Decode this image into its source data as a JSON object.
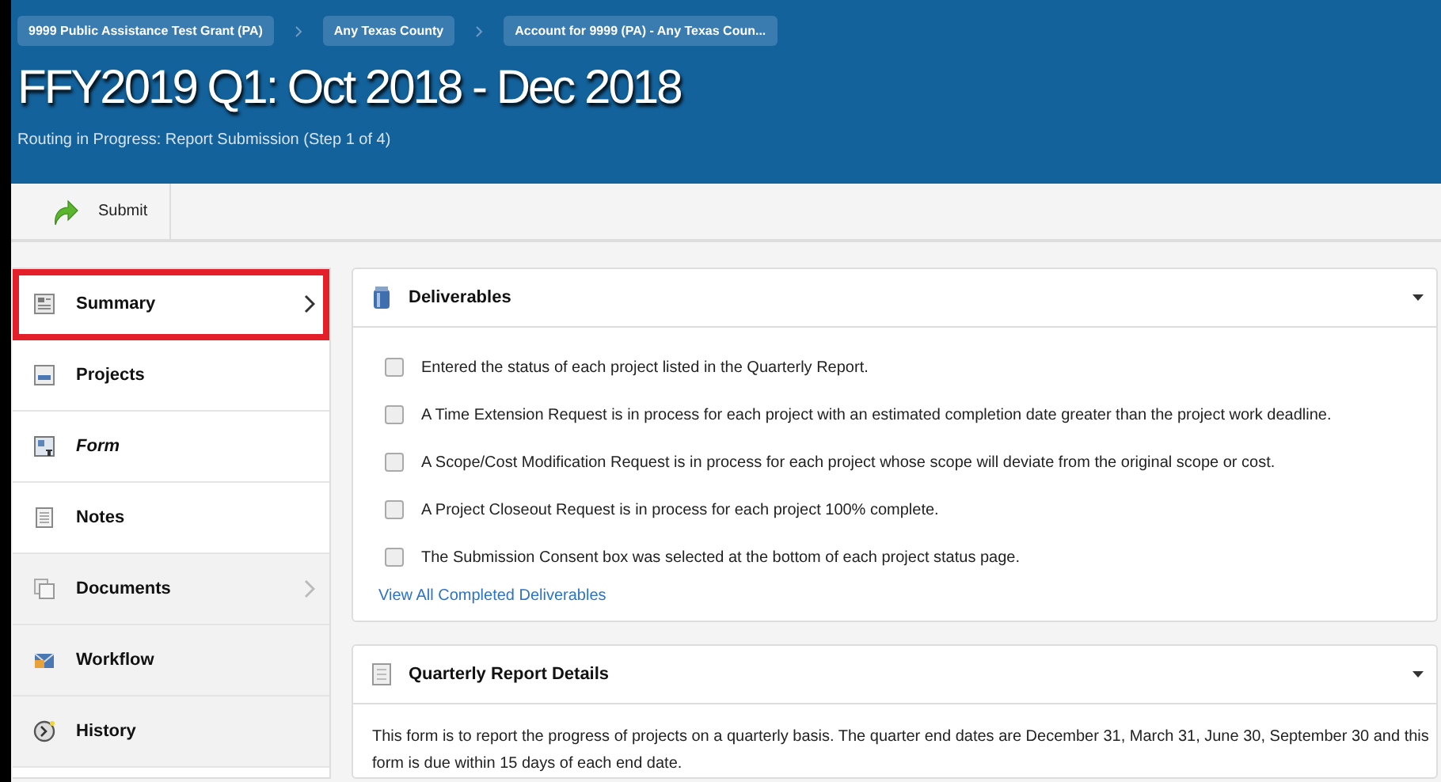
{
  "breadcrumbs": [
    "9999 Public Assistance Test Grant (PA)",
    "Any Texas County",
    "Account for 9999 (PA) - Any Texas Coun..."
  ],
  "title": "FFY2019 Q1: Oct 2018 - Dec 2018",
  "subtitle": "Routing in Progress: Report Submission (Step 1 of 4)",
  "toolbar": [
    {
      "label": "Submit",
      "kind": "submit"
    }
  ],
  "sidebar": {
    "items": [
      {
        "label": "Summary",
        "highlighted": true,
        "chevron": true,
        "italic": false,
        "shaded": false
      },
      {
        "label": "Projects",
        "highlighted": false,
        "chevron": false,
        "italic": false,
        "shaded": false
      },
      {
        "label": "Form",
        "highlighted": false,
        "chevron": false,
        "italic": true,
        "shaded": false
      },
      {
        "label": "Notes",
        "highlighted": false,
        "chevron": false,
        "italic": false,
        "shaded": false
      },
      {
        "label": "Documents",
        "highlighted": false,
        "chevron": true,
        "italic": false,
        "shaded": true
      },
      {
        "label": "Workflow",
        "highlighted": false,
        "chevron": false,
        "italic": false,
        "shaded": true
      },
      {
        "label": "History",
        "highlighted": false,
        "chevron": false,
        "italic": false,
        "shaded": true
      }
    ]
  },
  "deliverables": {
    "title": "Deliverables",
    "items": [
      {
        "text": "Entered the status of each project listed in the Quarterly Report.",
        "checked": false
      },
      {
        "text": "A Time Extension Request is in process for each project with an estimated completion date greater than the project work deadline.",
        "checked": false
      },
      {
        "text": "A Scope/Cost Modification Request is in process for each project whose scope will deviate from the original scope or cost.",
        "checked": false
      },
      {
        "text": "A Project Closeout Request is in process for each project 100% complete.",
        "checked": false
      },
      {
        "text": "The Submission Consent box was selected at the bottom of each project status page.",
        "checked": false
      }
    ],
    "link": "View All Completed Deliverables"
  },
  "details": {
    "title": "Quarterly Report Details",
    "text": "This form is to report the progress of projects on a quarterly basis. The quarter end dates are December 31, March 31, June 30, September 30 and this form is due within 15 days of each end date."
  }
}
